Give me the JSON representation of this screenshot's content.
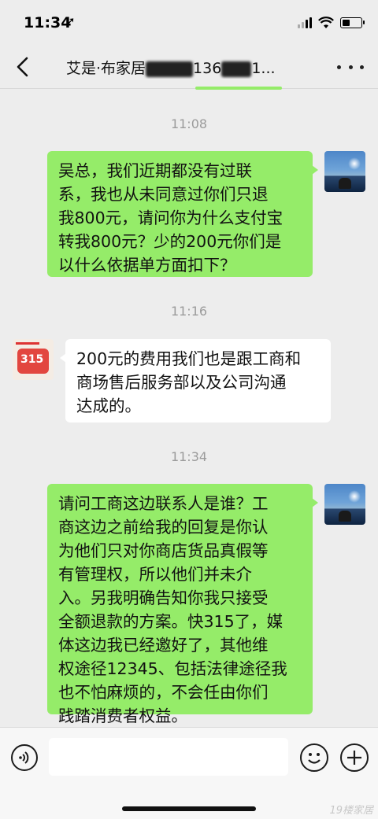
{
  "status_bar": {
    "time": "11:34",
    "arrow": "➚"
  },
  "nav": {
    "title_part1": "艾是·布家居",
    "title_part2": "136",
    "title_part3": "1...",
    "back_icon": "chevron-left-icon",
    "more_icon": "ellipsis-icon"
  },
  "messages": [
    {
      "timestamp": "11:08",
      "sender": "me",
      "lines": [
        "吴总，我们近期都没有过联",
        "系，我也从未同意过你们只退",
        "我800元，请问你为什么支付宝",
        "转我800元？少的200元你们是",
        "以什么依据单方面扣下？"
      ]
    },
    {
      "timestamp": "11:16",
      "sender": "them",
      "lines": [
        "200元的费用我们也是跟工商和",
        "商场售后服务部以及公司沟通",
        "达成的。"
      ],
      "avatar_text": "315"
    },
    {
      "timestamp": "11:34",
      "sender": "me",
      "lines": [
        "请问工商这边联系人是谁？工",
        "商这边之前给我的回复是你认",
        "为他们只对你商店货品真假等",
        "有管理权，所以他们并未介",
        "入。另我明确告知你我只接受",
        "全额退款的方案。快315了，媒",
        "体这边我已经邀好了，其他维",
        "权途径12345、包括法律途径我",
        "也不怕麻烦的，不会任由你们",
        "践踏消费者权益。"
      ]
    }
  ],
  "input_bar": {
    "placeholder": "",
    "watermark": "19楼家居"
  },
  "colors": {
    "my_bubble": "#95ec69",
    "their_bubble": "#ffffff",
    "background": "#ededed"
  }
}
